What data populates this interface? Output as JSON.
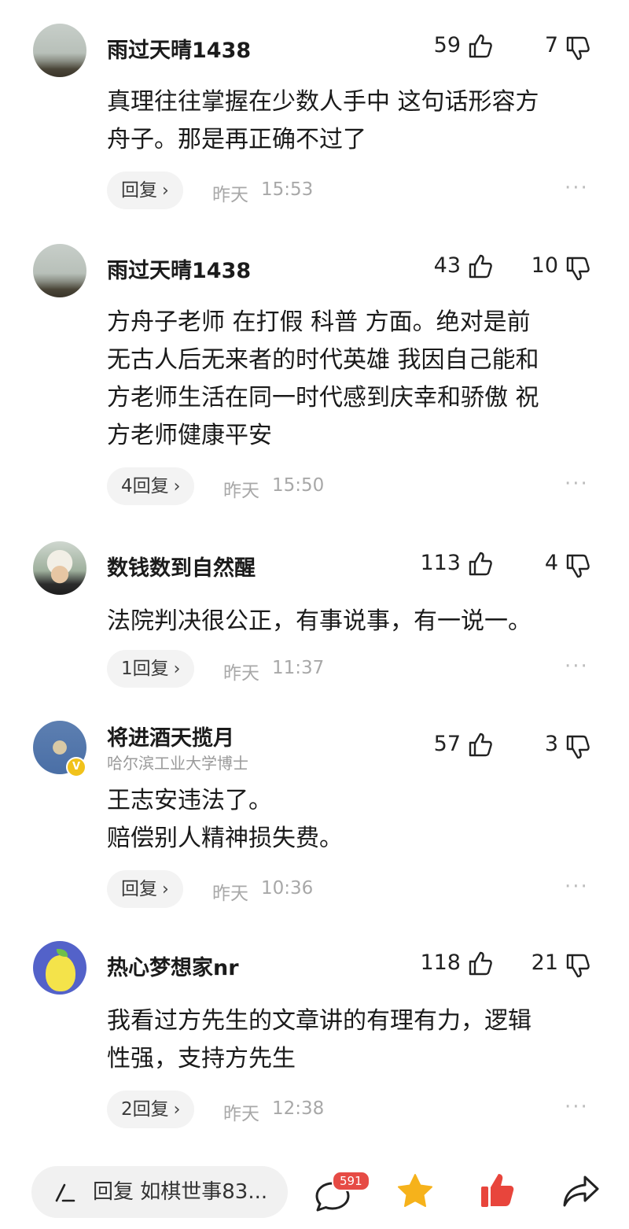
{
  "comments": [
    {
      "name": "雨过天晴1438",
      "subtitle": "",
      "likes": "59",
      "dislikes": "7",
      "text": "真理往往掌握在少数人手中 这句话形容方\n舟子。那是再正确不过了",
      "reply_label": "回复",
      "reply_chevron": "›",
      "day": "昨天",
      "time": "15:53",
      "more": "···",
      "avatar": "rainbow-landscape"
    },
    {
      "name": "雨过天晴1438",
      "subtitle": "",
      "likes": "43",
      "dislikes": "10",
      "text": "方舟子老师 在打假 科普 方面。绝对是前\n无古人后无来者的时代英雄 我因自己能和\n方老师生活在同一时代感到庆幸和骄傲 祝\n方老师健康平安",
      "reply_label": "4回复",
      "reply_chevron": "›",
      "day": "昨天",
      "time": "15:50",
      "more": "···",
      "avatar": "rainbow-landscape"
    },
    {
      "name": "数钱数到自然醒",
      "subtitle": "",
      "likes": "113",
      "dislikes": "4",
      "text": "法院判决很公正，有事说事，有一说一。",
      "reply_label": "1回复",
      "reply_chevron": "›",
      "day": "昨天",
      "time": "11:37",
      "more": "···",
      "avatar": "person-with-hat"
    },
    {
      "name": "将进酒天揽月",
      "subtitle": "哈尔滨工业大学博士",
      "likes": "57",
      "dislikes": "3",
      "text": "王志安违法了。\n赔偿别人精神损失费。",
      "reply_label": "回复",
      "reply_chevron": "›",
      "day": "昨天",
      "time": "10:36",
      "more": "···",
      "avatar": "fighter-jet",
      "verified_badge": "V"
    },
    {
      "name": "热心梦想家nr",
      "subtitle": "",
      "likes": "118",
      "dislikes": "21",
      "text": "我看过方先生的文章讲的有理有力，逻辑\n性强，支持方先生",
      "reply_label": "2回复",
      "reply_chevron": "›",
      "day": "昨天",
      "time": "12:38",
      "more": "···",
      "avatar": "cartoon-lemon"
    }
  ],
  "bottom_bar": {
    "reply_placeholder": "回复 如棋世事83...",
    "comment_count": "591",
    "icons": [
      "pen-icon",
      "comment-icon",
      "star-icon",
      "thumbs-up-icon",
      "share-icon"
    ]
  },
  "colors": {
    "badge": "#e64b45",
    "star": "#f6b21b",
    "like_active": "#e8453c",
    "pill_bg": "#f3f3f3"
  }
}
